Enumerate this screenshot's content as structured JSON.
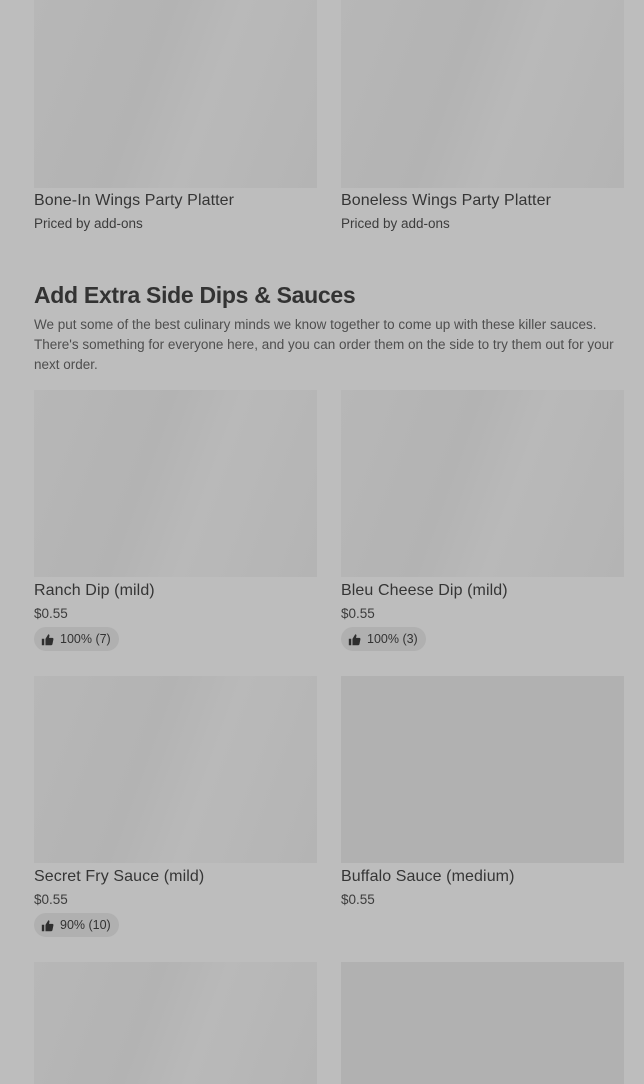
{
  "top_items": [
    {
      "name": "Bone-In Wings Party Platter",
      "price": "Priced by add-ons"
    },
    {
      "name": "Boneless Wings Party Platter",
      "price": "Priced by add-ons"
    }
  ],
  "section": {
    "title": "Add Extra Side Dips & Sauces",
    "description": "We put some of the best culinary minds we know together to come up with these killer sauces. There's something for everyone here, and you can order them on the side to try them out for your next order."
  },
  "items": [
    {
      "name": "Ranch Dip (mild)",
      "price": "$0.55",
      "rating": "100% (7)"
    },
    {
      "name": "Bleu Cheese Dip (mild)",
      "price": "$0.55",
      "rating": "100% (3)"
    },
    {
      "name": "Secret Fry Sauce (mild)",
      "price": "$0.55",
      "rating": "90% (10)"
    },
    {
      "name": "Buffalo Sauce (medium)",
      "price": "$0.55"
    }
  ],
  "icons": {
    "rating": "thumbs-up-icon"
  },
  "colors": {
    "background": "#bdbdbd",
    "image_placeholder": "#b3b3b3",
    "text": "#333333"
  }
}
